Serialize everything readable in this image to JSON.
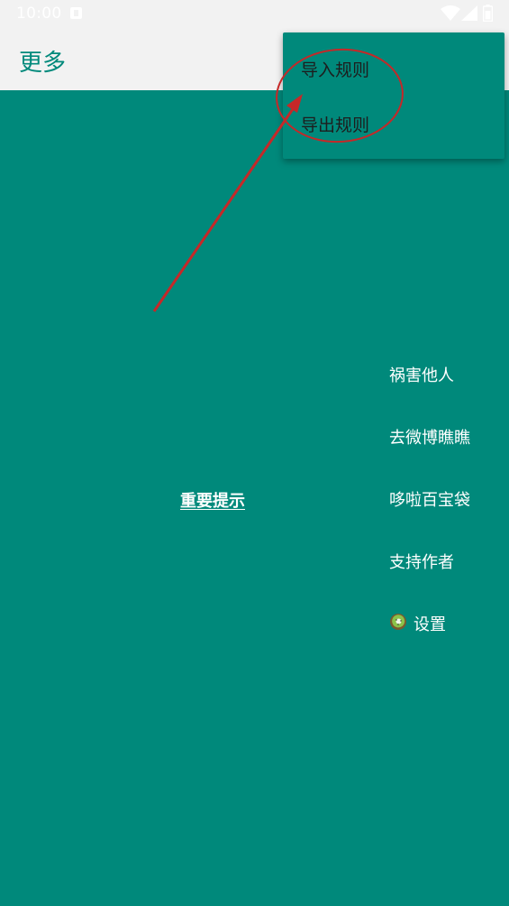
{
  "status_bar": {
    "time": "10:00",
    "icons": [
      "notification-icon",
      "wifi-icon",
      "signal-icon",
      "battery-icon"
    ]
  },
  "app_bar": {
    "title": "更多"
  },
  "overflow_menu": {
    "items": [
      {
        "label": "导入规则"
      },
      {
        "label": "导出规则"
      }
    ]
  },
  "main": {
    "tip_link": "重要提示"
  },
  "side_menu": {
    "items": [
      {
        "label": "祸害他人"
      },
      {
        "label": "去微博瞧瞧"
      },
      {
        "label": "哆啦百宝袋"
      },
      {
        "label": "支持作者"
      },
      {
        "label": "设置",
        "icon": "kiwi-icon"
      }
    ]
  },
  "annotation": {
    "shapes": [
      "red-ellipse",
      "red-arrow"
    ],
    "color": "#c62828"
  },
  "colors": {
    "primary": "#00897b",
    "app_bar_bg": "#f2f2f2",
    "menu_text": "#1d1d1d",
    "white": "#ffffff"
  }
}
